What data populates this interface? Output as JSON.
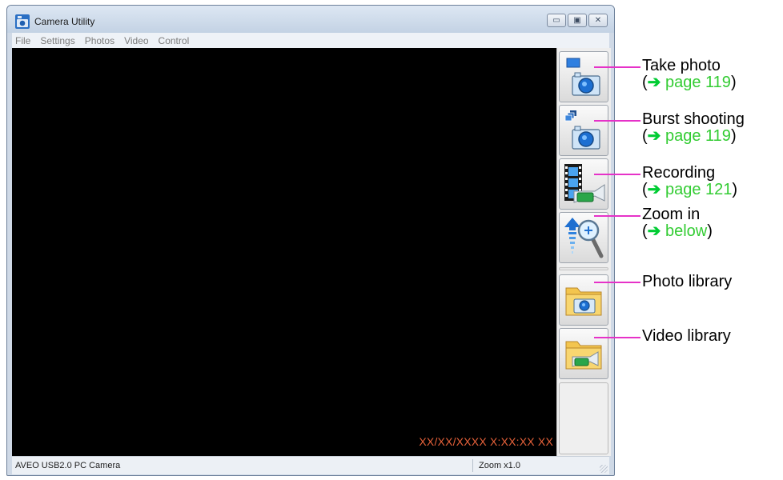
{
  "window": {
    "title": "Camera Utility",
    "controls": [
      "minimize",
      "maximize",
      "close"
    ]
  },
  "menu": [
    "File",
    "Settings",
    "Photos",
    "Video",
    "Control"
  ],
  "viewport": {
    "timestamp": "XX/XX/XXXX X:XX:XX XX"
  },
  "toolbar": {
    "buttons": [
      {
        "name": "take-photo",
        "icon": "camera-single-icon"
      },
      {
        "name": "burst-shooting",
        "icon": "camera-burst-icon"
      },
      {
        "name": "recording",
        "icon": "film-camcorder-icon"
      },
      {
        "name": "zoom-in",
        "icon": "zoom-magnifier-icon"
      },
      {
        "name": "photo-library",
        "icon": "folder-camera-icon"
      },
      {
        "name": "video-library",
        "icon": "folder-camcorder-icon"
      }
    ]
  },
  "status": {
    "device": "AVEO USB2.0 PC Camera",
    "zoom": "Zoom x1.0"
  },
  "callouts": [
    {
      "label": "Take photo",
      "ref_arrow": "➔",
      "ref_text": " page 119",
      "open": "(",
      "close": ")"
    },
    {
      "label": "Burst shooting",
      "ref_arrow": "➔",
      "ref_text": " page 119",
      "open": "(",
      "close": ")"
    },
    {
      "label": "Recording",
      "ref_arrow": "➔",
      "ref_text": " page 121",
      "open": "(",
      "close": ")"
    },
    {
      "label": "Zoom in",
      "ref_arrow": "➔",
      "ref_text": " below",
      "open": "(",
      "close": ")"
    },
    {
      "label": "Photo library"
    },
    {
      "label": "Video library"
    }
  ],
  "colors": {
    "callout_line": "#e632c8",
    "ref_green": "#33cc33",
    "timestamp": "#e8623a"
  }
}
